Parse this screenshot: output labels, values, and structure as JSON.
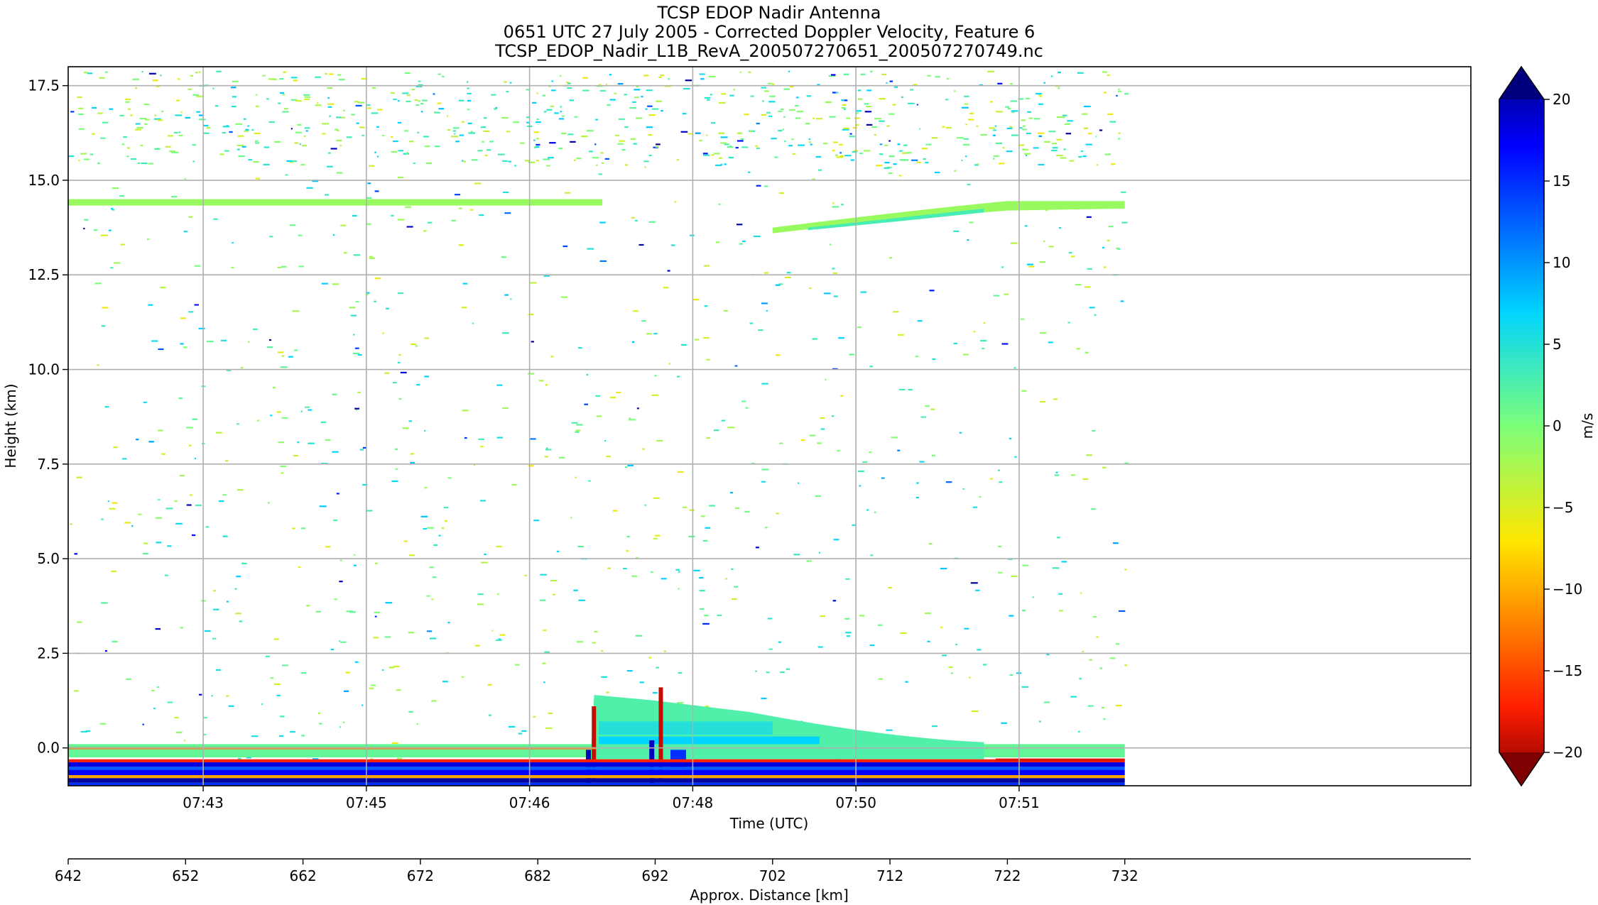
{
  "chart_data": {
    "type": "heatmap",
    "title_lines": [
      "TCSP EDOP Nadir Antenna",
      "0651 UTC 27 July 2005 - Corrected Doppler Velocity, Feature 6",
      "TCSP_EDOP_Nadir_L1B_RevA_200507270651_200507270749.nc"
    ],
    "xlabel": "Time (UTC)",
    "ylabel": "Height (km)",
    "x2label": "Approx. Distance [km]",
    "x_time_ticks": [
      "07:43",
      "07:45",
      "07:46",
      "07:48",
      "07:50",
      "07:51"
    ],
    "y_ticks": [
      "17.5",
      "15.0",
      "12.5",
      "10.0",
      "7.5",
      "5.0",
      "2.5",
      "0.0"
    ],
    "y_tick_values": [
      17.5,
      15.0,
      12.5,
      10.0,
      7.5,
      5.0,
      2.5,
      0.0
    ],
    "ylim": [
      -1.0,
      18.0
    ],
    "distance_ticks": [
      "642",
      "652",
      "662",
      "672",
      "682",
      "692",
      "702",
      "712",
      "722",
      "732"
    ],
    "distance_tick_values": [
      642,
      652,
      662,
      672,
      682,
      692,
      702,
      712,
      722,
      732
    ],
    "distance_range": [
      642,
      702
    ],
    "data_extent_km": [
      642,
      732
    ],
    "grid": true,
    "colorbar": {
      "label": "m/s",
      "ticks": [
        "20",
        "15",
        "10",
        "5",
        "0",
        "−5",
        "−10",
        "−15",
        "−20"
      ],
      "tick_values": [
        20,
        15,
        10,
        5,
        0,
        -5,
        -10,
        -15,
        -20
      ],
      "range": [
        -20,
        20
      ],
      "colormap": "jet_r",
      "extend": "both"
    },
    "features": {
      "tropopause_layer_height_km": 14.35,
      "near_surface_echo_top_km": 0.1,
      "convective_cell_top_km": 1.4
    }
  }
}
